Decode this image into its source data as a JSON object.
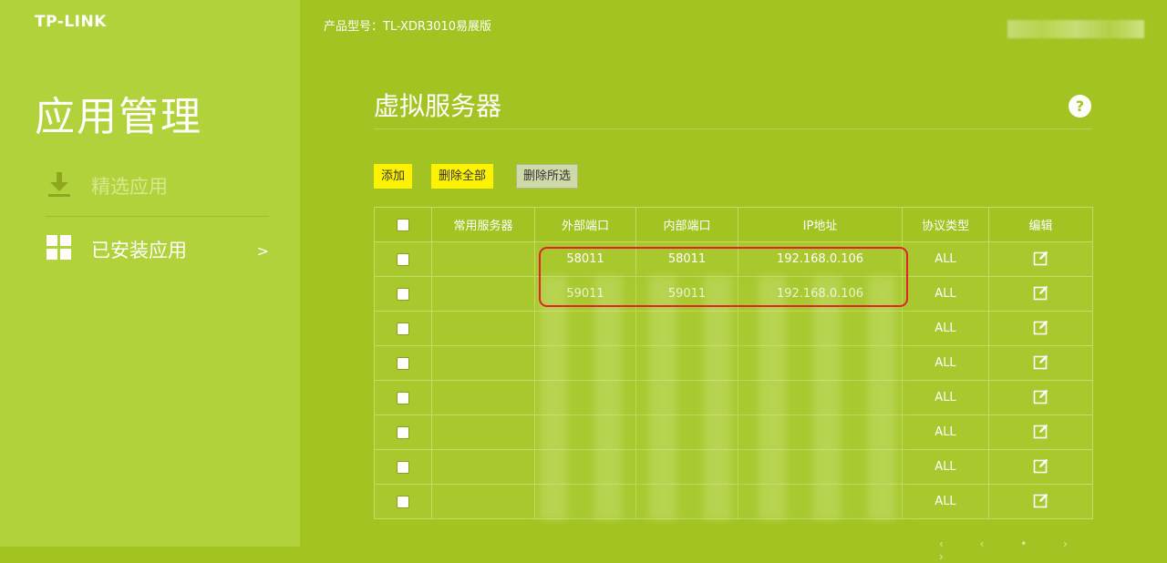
{
  "brand": "TP-LINK",
  "header": {
    "model_label": "产品型号：TL-XDR3010易展版"
  },
  "sidebar": {
    "title": "应用管理",
    "items": [
      {
        "label": "精选应用",
        "icon": "download-icon",
        "active": false
      },
      {
        "label": "已安装应用",
        "icon": "grid-icon",
        "active": true,
        "chevron": ">"
      }
    ]
  },
  "main": {
    "title": "虚拟服务器",
    "help": "?",
    "buttons": {
      "add": "添加",
      "delete_all": "删除全部",
      "delete_selected": "删除所选"
    },
    "table": {
      "columns": [
        "常用服务器",
        "外部端口",
        "内部端口",
        "IP地址",
        "协议类型",
        "编辑"
      ],
      "rows": [
        {
          "service": "",
          "ext_port": "58011",
          "int_port": "58011",
          "ip": "192.168.0.106",
          "protocol": "ALL"
        },
        {
          "service": "",
          "ext_port": "59011",
          "int_port": "59011",
          "ip": "192.168.0.106",
          "protocol": "ALL"
        },
        {
          "service": "",
          "ext_port": "",
          "int_port": "",
          "ip": "",
          "protocol": "ALL"
        },
        {
          "service": "",
          "ext_port": "",
          "int_port": "",
          "ip": "",
          "protocol": "ALL"
        },
        {
          "service": "",
          "ext_port": "",
          "int_port": "",
          "ip": "",
          "protocol": "ALL"
        },
        {
          "service": "",
          "ext_port": "",
          "int_port": "",
          "ip": "",
          "protocol": "ALL"
        },
        {
          "service": "",
          "ext_port": "",
          "int_port": "",
          "ip": "",
          "protocol": "ALL"
        },
        {
          "service": "",
          "ext_port": "",
          "int_port": "",
          "ip": "",
          "protocol": "ALL"
        }
      ]
    }
  },
  "colors": {
    "page_bg": "#a2c322",
    "sidebar_bg": "#b2d23c",
    "button_yellow": "#fff200",
    "highlight_red": "#e2222c"
  }
}
